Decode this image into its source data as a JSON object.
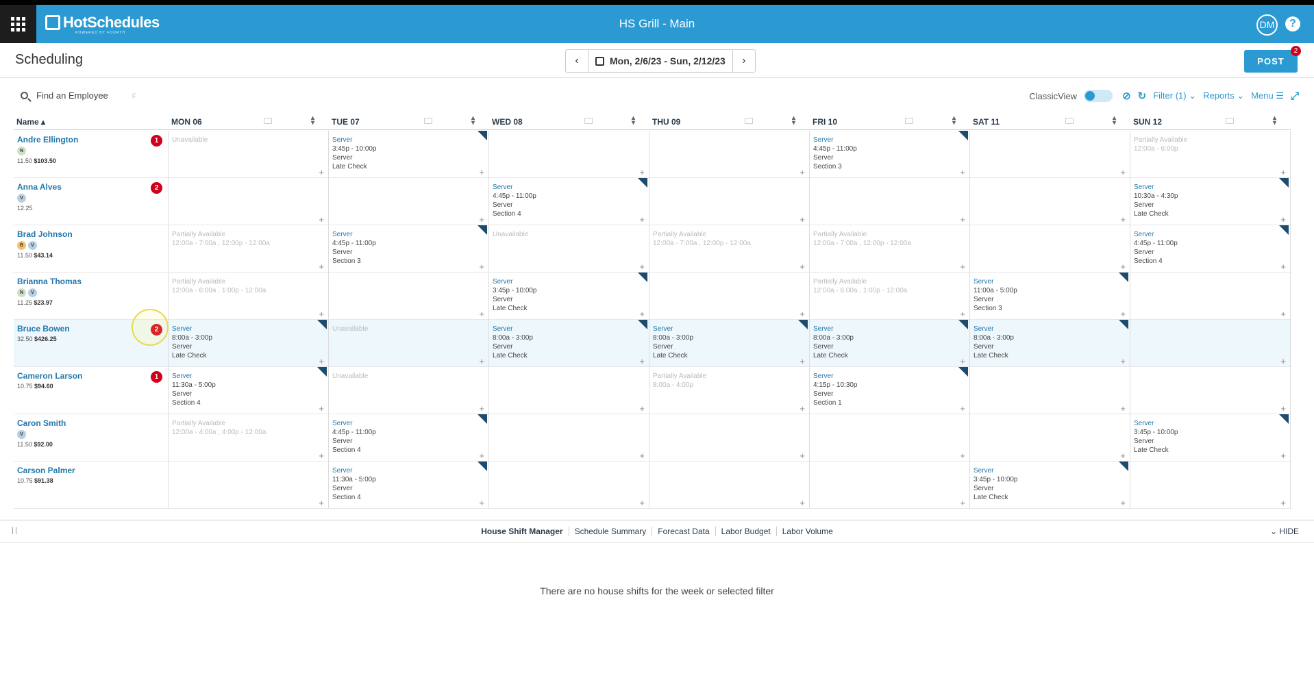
{
  "app": {
    "title": "HS Grill - Main",
    "logo": "HotSchedules",
    "logo_tagline": "POWERED BY FOURTH",
    "user_initials": "DM",
    "help": "?"
  },
  "header": {
    "page_title": "Scheduling",
    "date_range": "Mon, 2/6/23 - Sun, 2/12/23",
    "post_label": "POST",
    "post_badge": "2"
  },
  "toolbar": {
    "search_placeholder": "Find an Employee",
    "search_hint": "F",
    "classic_view": "ClassicView",
    "filter": "Filter (1)",
    "reports": "Reports",
    "menu": "Menu"
  },
  "grid": {
    "name_header": "Name",
    "days": [
      "MON 06",
      "TUE 07",
      "WED 08",
      "THU 09",
      "FRI 10",
      "SAT 11",
      "SUN 12"
    ],
    "employees": [
      {
        "name": "Andre Ellington",
        "badge": "1",
        "tags": [
          "N"
        ],
        "pay": "11.50",
        "total": "$103.50",
        "cells": [
          {
            "t": "u",
            "text": "Unavailable"
          },
          {
            "t": "s",
            "role": "Server",
            "time": "3:45p - 10:00p",
            "pos": "Server",
            "sec": "Late Check"
          },
          {
            "t": "e"
          },
          {
            "t": "e"
          },
          {
            "t": "s",
            "role": "Server",
            "time": "4:45p - 11:00p",
            "pos": "Server",
            "sec": "Section 3"
          },
          {
            "t": "e"
          },
          {
            "t": "u",
            "text": "Partially Available",
            "text2": "12:00a - 6:00p"
          }
        ]
      },
      {
        "name": "Anna Alves",
        "badge": "2",
        "tags": [
          "V"
        ],
        "pay": "12.25",
        "total": "",
        "cells": [
          {
            "t": "e"
          },
          {
            "t": "e"
          },
          {
            "t": "s",
            "role": "Server",
            "time": "4:45p - 11:00p",
            "pos": "Server",
            "sec": "Section 4"
          },
          {
            "t": "e"
          },
          {
            "t": "e"
          },
          {
            "t": "e"
          },
          {
            "t": "s",
            "role": "Server",
            "time": "10:30a - 4:30p",
            "pos": "Server",
            "sec": "Late Check"
          }
        ]
      },
      {
        "name": "Brad Johnson",
        "badge": "",
        "tags": [
          "B",
          "V"
        ],
        "pay": "11.50",
        "total": "$43.14",
        "cells": [
          {
            "t": "u",
            "text": "Partially Available",
            "text2": "12:00a - 7:00a , 12:00p - 12:00a"
          },
          {
            "t": "s",
            "role": "Server",
            "time": "4:45p - 11:00p",
            "pos": "Server",
            "sec": "Section 3"
          },
          {
            "t": "u",
            "text": "Unavailable"
          },
          {
            "t": "u",
            "text": "Partially Available",
            "text2": "12:00a - 7:00a , 12:00p - 12:00a"
          },
          {
            "t": "u",
            "text": "Partially Available",
            "text2": "12:00a - 7:00a , 12:00p - 12:00a"
          },
          {
            "t": "e"
          },
          {
            "t": "s",
            "role": "Server",
            "time": "4:45p - 11:00p",
            "pos": "Server",
            "sec": "Section 4"
          }
        ]
      },
      {
        "name": "Brianna Thomas",
        "badge": "",
        "tags": [
          "N",
          "V"
        ],
        "pay": "11.25",
        "total": "$23.97",
        "cells": [
          {
            "t": "u",
            "text": "Partially Available",
            "text2": "12:00a - 6:00a , 1:00p - 12:00a"
          },
          {
            "t": "e"
          },
          {
            "t": "s",
            "role": "Server",
            "time": "3:45p - 10:00p",
            "pos": "Server",
            "sec": "Late Check"
          },
          {
            "t": "e"
          },
          {
            "t": "u",
            "text": "Partially Available",
            "text2": "12:00a - 6:00a , 1:00p - 12:00a"
          },
          {
            "t": "s",
            "role": "Server",
            "time": "11:00a - 5:00p",
            "pos": "Server",
            "sec": "Section 3"
          },
          {
            "t": "e"
          }
        ]
      },
      {
        "name": "Bruce Bowen",
        "badge": "2",
        "tags": [],
        "pay": "32.50",
        "total": "$426.25",
        "selected": true,
        "cells": [
          {
            "t": "s",
            "role": "Server",
            "time": "8:00a - 3:00p",
            "pos": "Server",
            "sec": "Late Check"
          },
          {
            "t": "u",
            "text": "Unavailable"
          },
          {
            "t": "s",
            "role": "Server",
            "time": "8:00a - 3:00p",
            "pos": "Server",
            "sec": "Late Check"
          },
          {
            "t": "s",
            "role": "Server",
            "time": "8:00a - 3:00p",
            "pos": "Server",
            "sec": "Late Check"
          },
          {
            "t": "s",
            "role": "Server",
            "time": "8:00a - 3:00p",
            "pos": "Server",
            "sec": "Late Check"
          },
          {
            "t": "s",
            "role": "Server",
            "time": "8:00a - 3:00p",
            "pos": "Server",
            "sec": "Late Check"
          },
          {
            "t": "e"
          }
        ]
      },
      {
        "name": "Cameron Larson",
        "badge": "1",
        "tags": [],
        "pay": "10.75",
        "total": "$94.60",
        "cells": [
          {
            "t": "s",
            "role": "Server",
            "time": "11:30a - 5:00p",
            "pos": "Server",
            "sec": "Section 4"
          },
          {
            "t": "u",
            "text": "Unavailable"
          },
          {
            "t": "e"
          },
          {
            "t": "u",
            "text": "Partially Available",
            "text2": "8:00a - 4:00p"
          },
          {
            "t": "s",
            "role": "Server",
            "time": "4:15p - 10:30p",
            "pos": "Server",
            "sec": "Section 1"
          },
          {
            "t": "e"
          },
          {
            "t": "e"
          }
        ]
      },
      {
        "name": "Caron Smith",
        "badge": "",
        "tags": [
          "V"
        ],
        "pay": "11.50",
        "total": "$92.00",
        "cells": [
          {
            "t": "u",
            "text": "Partially Available",
            "text2": "12:00a - 4:00a , 4:00p - 12:00a"
          },
          {
            "t": "s",
            "role": "Server",
            "time": "4:45p - 11:00p",
            "pos": "Server",
            "sec": "Section 4"
          },
          {
            "t": "e"
          },
          {
            "t": "e"
          },
          {
            "t": "e"
          },
          {
            "t": "e"
          },
          {
            "t": "s",
            "role": "Server",
            "time": "3:45p - 10:00p",
            "pos": "Server",
            "sec": "Late Check"
          }
        ]
      },
      {
        "name": "Carson Palmer",
        "badge": "",
        "tags": [],
        "pay": "10.75",
        "total": "$91.38",
        "cells": [
          {
            "t": "e"
          },
          {
            "t": "s",
            "role": "Server",
            "time": "11:30a - 5:00p",
            "pos": "Server",
            "sec": "Section 4"
          },
          {
            "t": "e"
          },
          {
            "t": "e"
          },
          {
            "t": "e"
          },
          {
            "t": "s",
            "role": "Server",
            "time": "3:45p - 10:00p",
            "pos": "Server",
            "sec": "Late Check"
          },
          {
            "t": "e"
          }
        ]
      }
    ]
  },
  "bottom": {
    "tabs": [
      "House Shift Manager",
      "Schedule Summary",
      "Forecast Data",
      "Labor Budget",
      "Labor Volume"
    ],
    "hide": "HIDE",
    "empty_message": "There are no house shifts for the week or selected filter"
  },
  "colors": {
    "brand": "#2b9ad2",
    "badge": "#d0021b",
    "link": "#2277aa"
  }
}
